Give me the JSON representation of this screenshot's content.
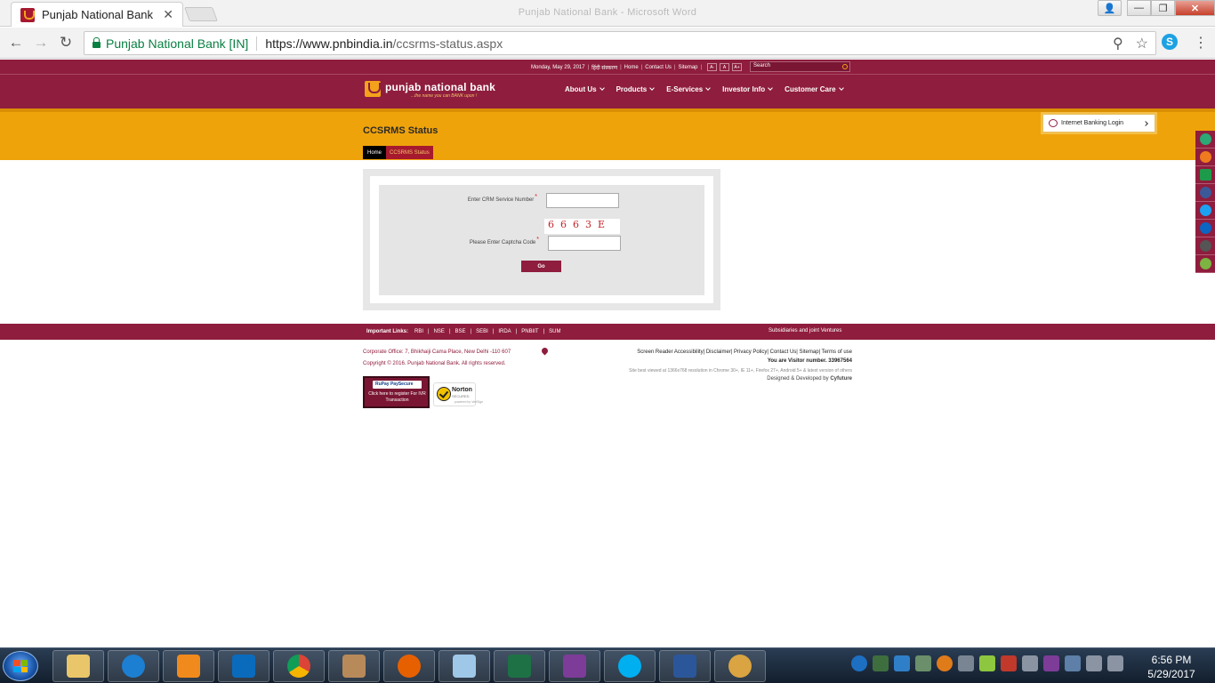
{
  "browser": {
    "tab_title": "Punjab National Bank",
    "tab_close": "✕",
    "window_title": "Punjab National Bank - Microsoft Word",
    "secure_name": "Punjab National Bank [IN]",
    "url_host": "https://www.pnbindia.in",
    "url_path": "/ccsrms-status.aspx",
    "back": "←",
    "forward": "→",
    "reload": "↻",
    "zoom": "⚲",
    "star": "☆",
    "skype": "S",
    "menu": "⋮",
    "win_user": "👤",
    "win_min": "—",
    "win_max": "❐",
    "win_close": "✕"
  },
  "site": {
    "date": "Monday, May 29, 2017",
    "hindi": "हिंदी संस्करण",
    "home": "Home",
    "contact": "Contact Us",
    "sitemap": "Sitemap",
    "font_small": "A-",
    "font_normal": "A",
    "font_large": "A+",
    "search_placeholder": "Search",
    "sep": "|",
    "logo_name": "punjab national bank",
    "logo_tagline": "...the name you can BANK upon !",
    "menu": [
      "About Us",
      "Products",
      "E-Services",
      "Investor Info",
      "Customer Care"
    ],
    "page_title": "CCSRMS Status",
    "crumb_home": "Home",
    "crumb_current": "CCSRMS Status",
    "ib_login": "Internet Banking Login"
  },
  "form": {
    "crm_label": "Enter CRM Service Number",
    "captcha_label": "Please Enter Captcha Code",
    "required": "*",
    "captcha_text": "6663E",
    "go": "Go"
  },
  "footer": {
    "important": "Important Links:",
    "links": [
      "RBI",
      "NSE",
      "BSE",
      "SEBI",
      "IRDA",
      "PNBIIT",
      "SUM"
    ],
    "subsidiaries": "Subsidiaries and joint Ventures",
    "corporate": "Corporate Office: 7, Bhikhaiji Cama Place, New Delhi -110 607",
    "copyright": "Copyright © 2016. Punjab National Bank. All rights reserved.",
    "right_links": "Screen Reader Accessibility| Disclaimer| Privacy Policy| Contact Us| Sitemap| Terms of use",
    "visitor_label": "You are Visitor number.",
    "visitor_number": "33967564",
    "best_viewed": "Site best viewed at 1366x768 resolution in Chrome 30+, IE 11+, Firefox 27+, Android 5+ & latest version of others",
    "designed": "Designed & Developed by",
    "developer": "Cyfuture",
    "rupay_logo": "RuPay PaySecure",
    "rupay_text": "Click here to register For IVR Transaction",
    "norton_name": "Norton",
    "norton_secured": "SECURED",
    "norton_powered": "powered by VeriSign"
  },
  "taskbar": {
    "time": "6:56 PM",
    "date": "5/29/2017"
  },
  "colors": {
    "maroon": "#8f1d3d",
    "gold": "#efa30b"
  }
}
